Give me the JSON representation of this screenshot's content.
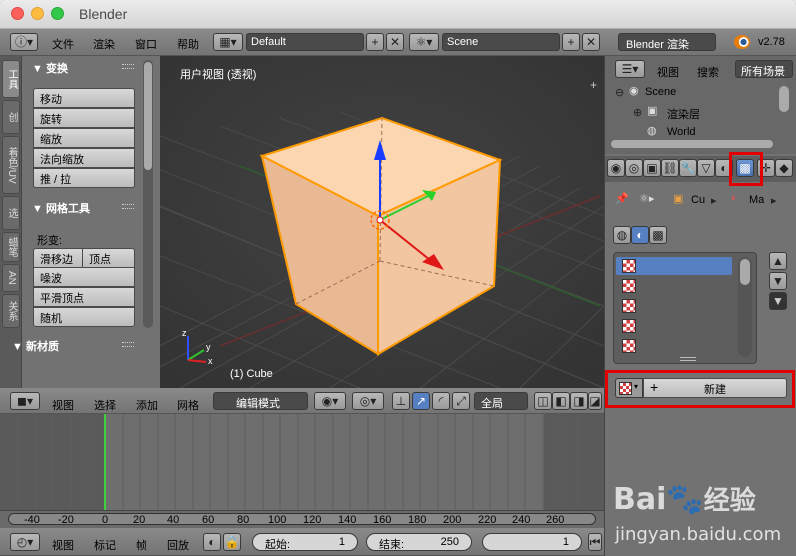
{
  "window": {
    "title": "Blender"
  },
  "top_menu": {
    "file": "文件",
    "render": "渲染",
    "window": "窗口",
    "help": "帮助",
    "screen_layout": "Default",
    "scene": "Scene",
    "engine": "Blender 渲染",
    "version": "v2.78"
  },
  "left_tabs": [
    "工具",
    "创",
    "着色/UV",
    "选",
    "蜡笔",
    "AN",
    "关系"
  ],
  "transform_section": {
    "title": "▼ 变换",
    "buttons": [
      "移动",
      "旋转",
      "缩放",
      "法向缩放",
      "推 / 拉"
    ]
  },
  "mesh_tools": {
    "title": "▼ 网格工具",
    "deform_label": "形变:",
    "buttons_row": [
      "滑移边",
      "顶点"
    ],
    "buttons": [
      "噪波",
      "平滑顶点",
      "随机"
    ]
  },
  "new_material": {
    "title": "▼ 新材质"
  },
  "viewport": {
    "label": "用户视图 (透视)",
    "object_label": "(1) Cube",
    "axes": {
      "x": "x",
      "y": "y",
      "z": "z"
    }
  },
  "viewport_header": {
    "view": "视图",
    "select": "选择",
    "add": "添加",
    "mesh": "网格",
    "mode": "编辑模式",
    "global": "全局"
  },
  "timeline_ruler": {
    "ticks": [
      "-40",
      "-20",
      "0",
      "20",
      "40",
      "60",
      "80",
      "100",
      "120",
      "140",
      "160",
      "180",
      "200",
      "220",
      "240",
      "260"
    ]
  },
  "timeline_header": {
    "view": "视图",
    "marker": "标记",
    "frame": "帧",
    "playback": "回放",
    "start_label": "起始:",
    "start_value": "1",
    "end_label": "结束:",
    "end_value": "250",
    "current": "1"
  },
  "outliner": {
    "view": "视图",
    "search": "搜索",
    "all_scenes": "所有场景",
    "items": [
      "Scene",
      "渲染层",
      "World"
    ]
  },
  "properties": {
    "context_object": "Cu",
    "context_material": "Ma",
    "new_button": "新建"
  },
  "watermark": {
    "site": "jingyan.baidu.com",
    "brand": "Bai",
    "brand2": "经验"
  },
  "colors": {
    "highlight_box": "#e00000",
    "selected_slot": "#5680c2",
    "cube_face": "#f5c9a0",
    "cube_edge": "#ff9a00"
  }
}
